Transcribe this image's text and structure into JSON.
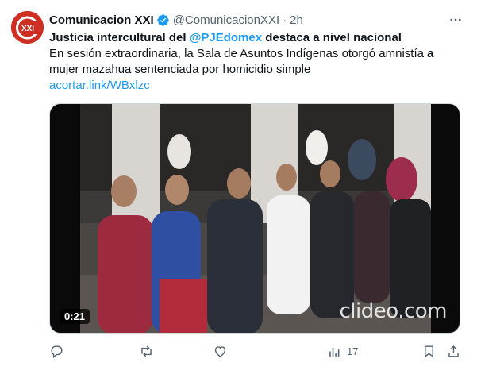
{
  "account": {
    "name": "Comunicacion XXI",
    "handle": "@ComunicacionXXI",
    "separator": "·",
    "time": "2h",
    "avatar_text": "XXI",
    "brand_color": "#cf2e22",
    "verified_color": "#1d9bf0"
  },
  "tweet": {
    "title_start": "Justicia intercultural del ",
    "title_mention": "@PJEdomex",
    "title_end": " destaca a nivel nacional",
    "body_start": "En sesión extraordinaria, la Sala de Asuntos Indígenas otorgó amnistía ",
    "body_bold": "a",
    "body_end": " mujer mazahua sentenciada por homicidio simple",
    "link": "acortar.link/WBxlzc"
  },
  "media": {
    "duration": "0:21",
    "watermark": "clideo.com"
  },
  "actions": {
    "reply_icon": "reply-icon",
    "retweet_icon": "retweet-icon",
    "like_icon": "heart-icon",
    "views_icon": "views-icon",
    "views_count": "17",
    "bookmark_icon": "bookmark-icon",
    "share_icon": "share-icon"
  },
  "colors": {
    "link": "#1d9bf0",
    "muted": "#536471"
  }
}
